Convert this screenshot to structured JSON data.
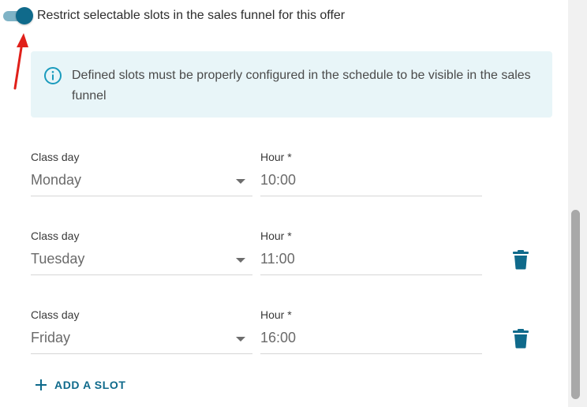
{
  "toggle": {
    "label": "Restrict selectable slots in the sales funnel for this offer",
    "checked": true,
    "accent": "#0f6a8b"
  },
  "info_banner": {
    "icon": "info-circle-icon",
    "text": "Defined slots must be properly configured in the schedule to be visible in the sales funnel",
    "background": "#e8f5f8"
  },
  "slots": [
    {
      "day_label": "Class day",
      "day_value": "Monday",
      "hour_label": "Hour *",
      "hour_value": "10:00",
      "deletable": false
    },
    {
      "day_label": "Class day",
      "day_value": "Tuesday",
      "hour_label": "Hour *",
      "hour_value": "11:00",
      "deletable": true
    },
    {
      "day_label": "Class day",
      "day_value": "Friday",
      "hour_label": "Hour *",
      "hour_value": "16:00",
      "deletable": true
    }
  ],
  "add_slot": {
    "icon": "plus-icon",
    "label": "ADD A SLOT"
  },
  "annotation": {
    "icon": "red-arrow-icon",
    "color": "#e0201a"
  }
}
